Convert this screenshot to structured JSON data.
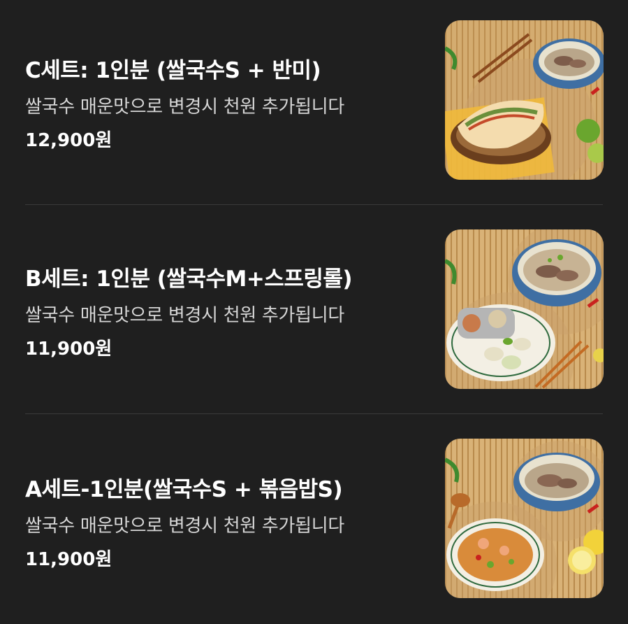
{
  "menu": {
    "items": [
      {
        "title": "C세트: 1인분 (쌀국수S + 반미)",
        "description": "쌀국수 매운맛으로 변경시 천원 추가됩니다",
        "price": "12,900원",
        "image": "pho-and-banh-mi-photo"
      },
      {
        "title": "B세트: 1인분 (쌀국수M+스프링롤)",
        "description": "쌀국수 매운맛으로 변경시 천원 추가됩니다",
        "price": "11,900원",
        "image": "pho-and-spring-rolls-photo"
      },
      {
        "title": "A세트-1인분(쌀국수S + 볶음밥S)",
        "description": "쌀국수 매운맛으로 변경시 천원 추가됩니다",
        "price": "11,900원",
        "image": "pho-and-fried-rice-photo"
      }
    ]
  },
  "colors": {
    "background": "#1f1f1f",
    "divider": "#3a3a3a",
    "title": "#ffffff",
    "description": "#d6d6d6",
    "price": "#ffffff"
  }
}
